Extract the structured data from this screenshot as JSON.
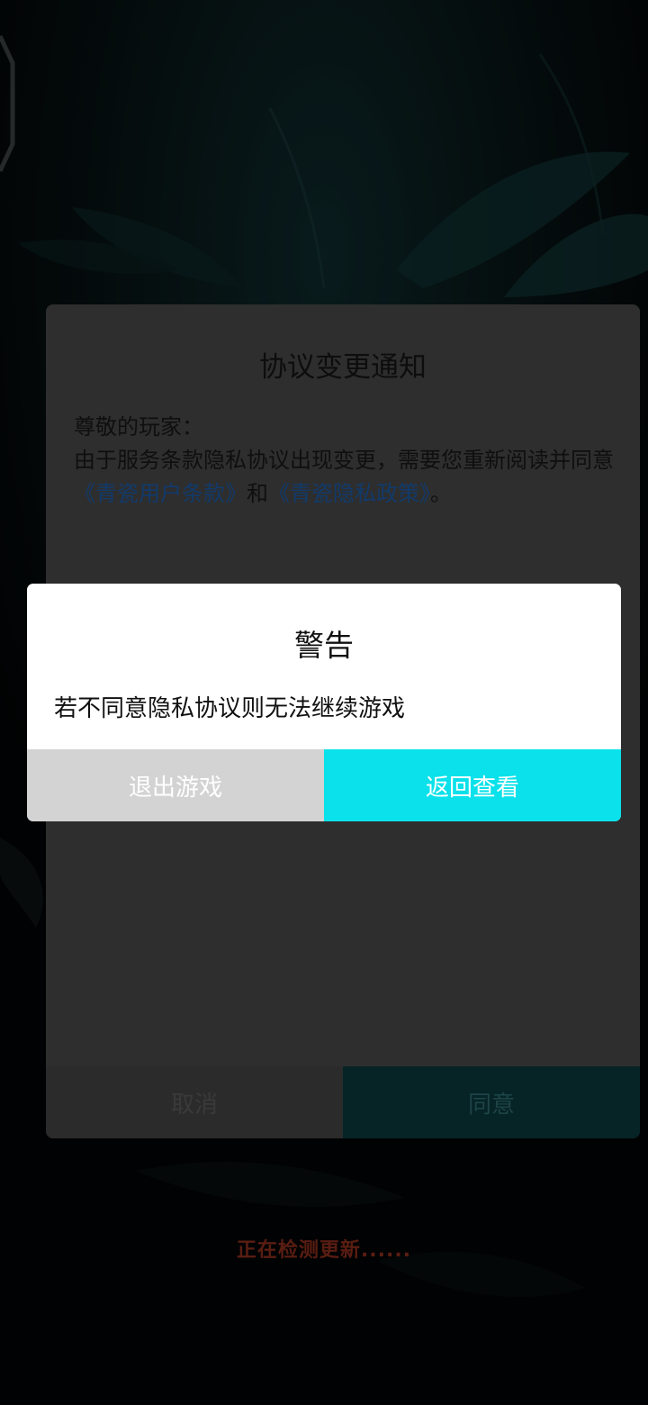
{
  "background": {
    "loading_text": "正在检测更新......",
    "accent_color": "#0ae1ea"
  },
  "agreement_dialog": {
    "title": "协议变更通知",
    "greeting": "尊敬的玩家：",
    "body_prefix": "由于服务条款隐私协议出现变更，需要您重新阅读并同意",
    "link_terms": "《青瓷用户条款》",
    "connector": "和",
    "link_privacy": "《青瓷隐私政策》",
    "body_suffix": "。",
    "cancel_label": "取消",
    "agree_label": "同意"
  },
  "warning_dialog": {
    "title": "警告",
    "message": "若不同意隐私协议则无法继续游戏",
    "exit_label": "退出游戏",
    "review_label": "返回查看",
    "exit_color": "#d3d3d3",
    "review_color": "#0ae1ea"
  }
}
